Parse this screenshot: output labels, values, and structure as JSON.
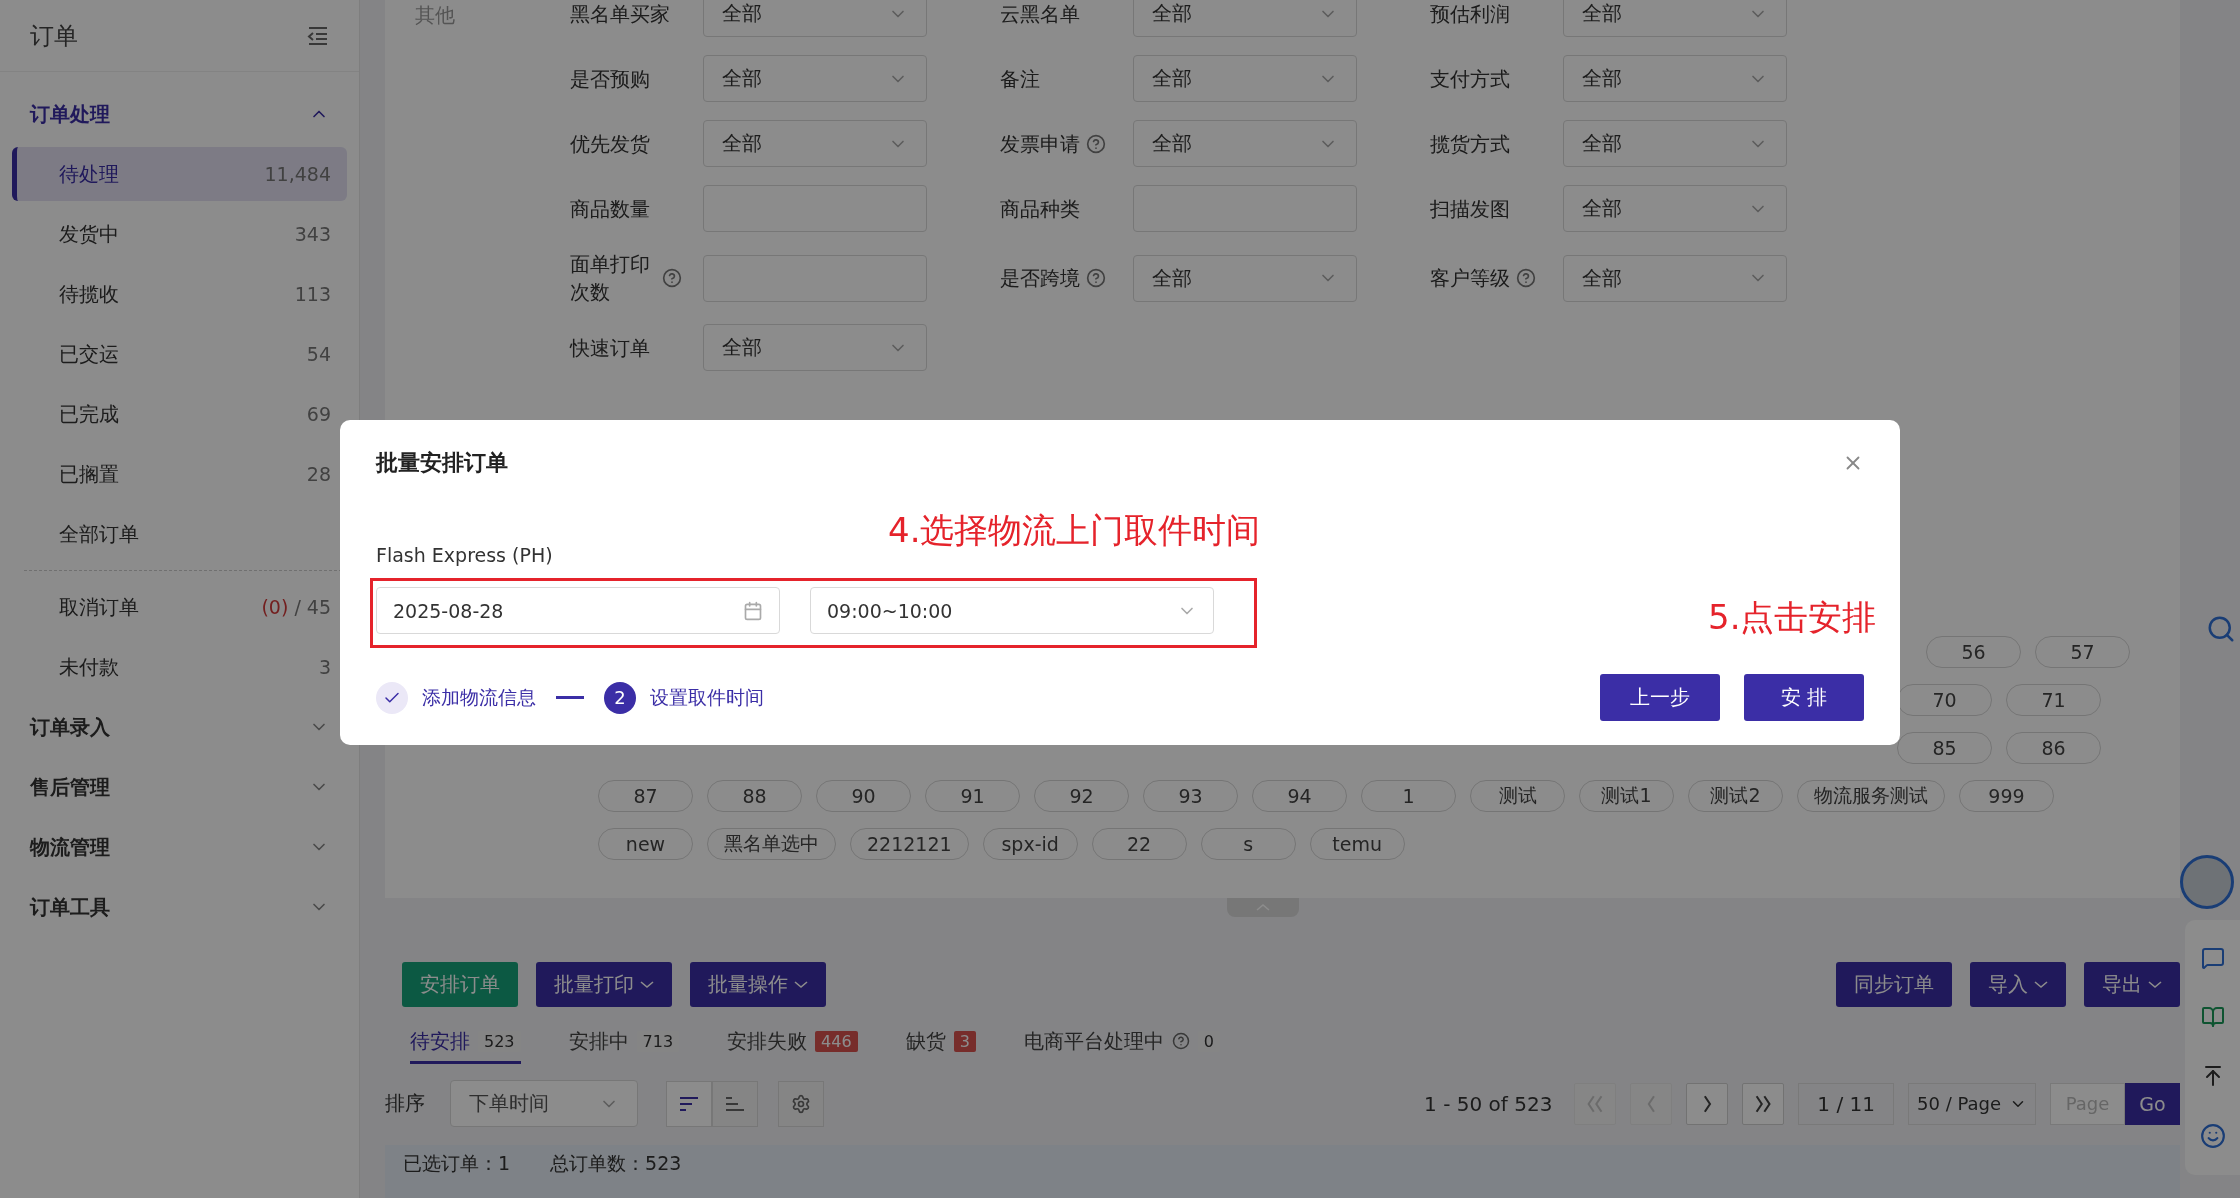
{
  "sidebar": {
    "title": "订单",
    "sections": [
      {
        "label": "订单处理",
        "expanded": true,
        "groups": [
          [
            {
              "label": "待处理",
              "count": "11,484",
              "selected": true
            },
            {
              "label": "发货中",
              "count": "343",
              "selected": false
            },
            {
              "label": "待揽收",
              "count": "113",
              "selected": false
            },
            {
              "label": "已交运",
              "count": "54",
              "selected": false
            },
            {
              "label": "已完成",
              "count": "69",
              "selected": false
            },
            {
              "label": "已搁置",
              "count": "28",
              "selected": false
            },
            {
              "label": "全部订单",
              "selected": false
            }
          ],
          [
            {
              "label": "取消订单",
              "alert_count": "(0)",
              "count": "/ 45",
              "selected": false
            },
            {
              "label": "未付款",
              "count": "3",
              "selected": false
            }
          ]
        ]
      },
      {
        "label": "订单录入",
        "expanded": false
      },
      {
        "label": "售后管理",
        "expanded": false
      },
      {
        "label": "物流管理",
        "expanded": false
      },
      {
        "label": "订单工具",
        "expanded": false
      }
    ]
  },
  "filters": {
    "group_label": "其他",
    "rows": [
      [
        {
          "label": "黑名单买家",
          "kind": "select",
          "value": "全部",
          "help": false
        },
        {
          "label": "云黑名单",
          "kind": "select",
          "value": "全部",
          "help": false
        },
        {
          "label": "预估利润",
          "kind": "select",
          "value": "全部",
          "help": false
        }
      ],
      [
        {
          "label": "是否预购",
          "kind": "select",
          "value": "全部",
          "help": false
        },
        {
          "label": "备注",
          "kind": "select",
          "value": "全部",
          "help": false
        },
        {
          "label": "支付方式",
          "kind": "select",
          "value": "全部",
          "help": false
        }
      ],
      [
        {
          "label": "优先发货",
          "kind": "select",
          "value": "全部",
          "help": false
        },
        {
          "label": "发票申请",
          "kind": "select",
          "value": "全部",
          "help": true
        },
        {
          "label": "揽货方式",
          "kind": "select",
          "value": "全部",
          "help": false
        }
      ],
      [
        {
          "label": "商品数量",
          "kind": "input",
          "help": false
        },
        {
          "label": "商品种类",
          "kind": "input",
          "help": false
        },
        {
          "label": "扫描发图",
          "kind": "select",
          "value": "全部",
          "help": false
        }
      ],
      [
        {
          "label": "面单打印次数",
          "kind": "input",
          "help": true
        },
        {
          "label": "是否跨境",
          "kind": "select",
          "value": "全部",
          "help": true
        },
        {
          "label": "客户等级",
          "kind": "select",
          "value": "全部",
          "help": true
        }
      ],
      [
        {
          "label": "快速订单",
          "kind": "select",
          "value": "全部",
          "help": false
        }
      ]
    ]
  },
  "tag_rows": [
    [
      "56",
      "57"
    ],
    [
      "70",
      "71"
    ],
    [
      "85",
      "86"
    ],
    [
      "87",
      "88",
      "90",
      "91",
      "92",
      "93",
      "94",
      "1",
      "测试",
      "测试1",
      "测试2",
      "物流服务测试",
      "999"
    ],
    [
      "new",
      "黑名单选中",
      "2212121",
      "spx-id",
      "22",
      "s",
      "temu"
    ]
  ],
  "toolbar": {
    "left": [
      {
        "label": "安排订单",
        "kind": "green",
        "menu": false
      },
      {
        "label": "批量打印",
        "kind": "purple",
        "menu": true
      },
      {
        "label": "批量操作",
        "kind": "purple",
        "menu": true
      }
    ],
    "right": [
      {
        "label": "同步订单",
        "kind": "purple",
        "menu": false
      },
      {
        "label": "导入",
        "kind": "purple",
        "menu": true
      },
      {
        "label": "导出",
        "kind": "purple",
        "menu": true
      }
    ]
  },
  "tabs": [
    {
      "label": "待安排",
      "count": "523",
      "selected": true,
      "alert": false,
      "help": false
    },
    {
      "label": "安排中",
      "count": "713",
      "selected": false,
      "alert": false,
      "help": false
    },
    {
      "label": "安排失败",
      "count": "446",
      "selected": false,
      "alert": true,
      "help": false
    },
    {
      "label": "缺货",
      "count": "3",
      "selected": false,
      "alert": true,
      "help": false
    },
    {
      "label": "电商平台处理中",
      "count": "0",
      "selected": false,
      "alert": false,
      "help": true
    }
  ],
  "sort": {
    "label": "排序",
    "value": "下单时间",
    "order_buttons": [
      {
        "selected": true
      },
      {
        "selected": false
      }
    ]
  },
  "pagination": {
    "range": "1 - 50 of 523",
    "nav": [
      {
        "disabled": true
      },
      {
        "disabled": true
      },
      {
        "disabled": false
      },
      {
        "disabled": false
      }
    ],
    "page": "1 / 11",
    "page_size": "50 / Page",
    "jump_placeholder": "Page",
    "go": "Go"
  },
  "summary": [
    "已选订单：1",
    "总订单数：523"
  ],
  "modal": {
    "title": "批量安排订单",
    "carrier_label": "Flash Express (PH)",
    "date_value": "2025-08-28",
    "time_value": "09:00~10:00",
    "steps": [
      {
        "label": "添加物流信息",
        "done": true
      },
      {
        "number": "2",
        "label": "设置取件时间",
        "done": false
      }
    ],
    "buttons": [
      "上一步",
      "安 排"
    ]
  },
  "annotations": [
    "4.选择物流上门取件时间",
    "5.点击安排"
  ]
}
